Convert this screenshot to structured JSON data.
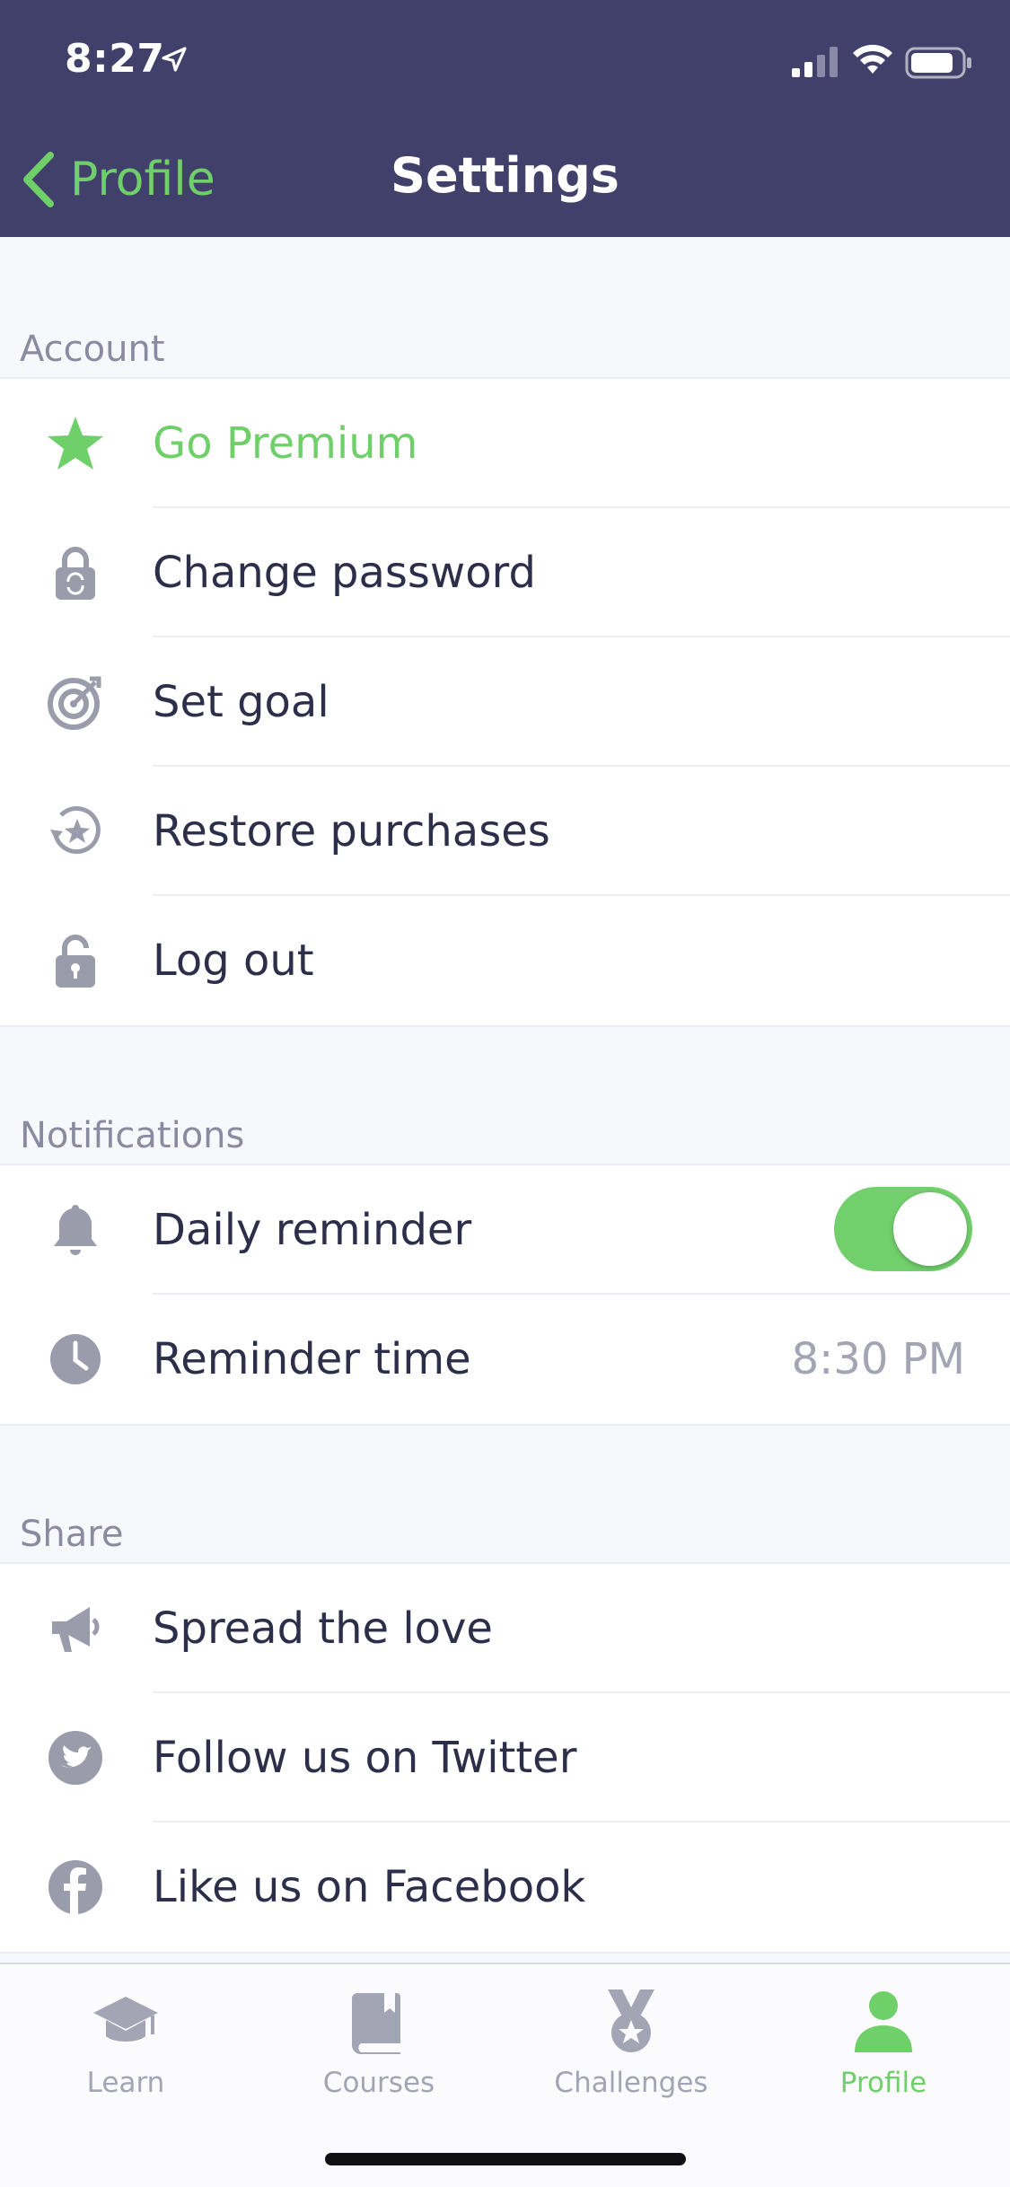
{
  "status_bar": {
    "time": "8:27"
  },
  "nav": {
    "back_label": "Profile",
    "title": "Settings"
  },
  "sections": {
    "account": {
      "label": "Account",
      "items": [
        {
          "label": "Go Premium",
          "icon": "star-icon"
        },
        {
          "label": "Change password",
          "icon": "lock-refresh-icon"
        },
        {
          "label": "Set goal",
          "icon": "target-icon"
        },
        {
          "label": "Restore purchases",
          "icon": "restore-star-icon"
        },
        {
          "label": "Log out",
          "icon": "unlock-icon"
        }
      ]
    },
    "notifications": {
      "label": "Notifications",
      "items": [
        {
          "label": "Daily reminder",
          "icon": "bell-icon",
          "toggle_on": true
        },
        {
          "label": "Reminder time",
          "icon": "clock-icon",
          "value": "8:30 PM"
        }
      ]
    },
    "share": {
      "label": "Share",
      "items": [
        {
          "label": "Spread the love",
          "icon": "megaphone-icon"
        },
        {
          "label": "Follow us on Twitter",
          "icon": "twitter-icon"
        },
        {
          "label": "Like us on Facebook",
          "icon": "facebook-icon"
        }
      ]
    }
  },
  "tabs": [
    {
      "label": "Learn",
      "icon": "graduation-cap-icon"
    },
    {
      "label": "Courses",
      "icon": "book-icon"
    },
    {
      "label": "Challenges",
      "icon": "medal-icon"
    },
    {
      "label": "Profile",
      "icon": "person-icon",
      "active": true
    }
  ],
  "colors": {
    "header_bg": "#40406a",
    "accent_green": "#6fd06a",
    "icon_gray": "#9a9bab",
    "text_dark": "#2d2f4a"
  }
}
